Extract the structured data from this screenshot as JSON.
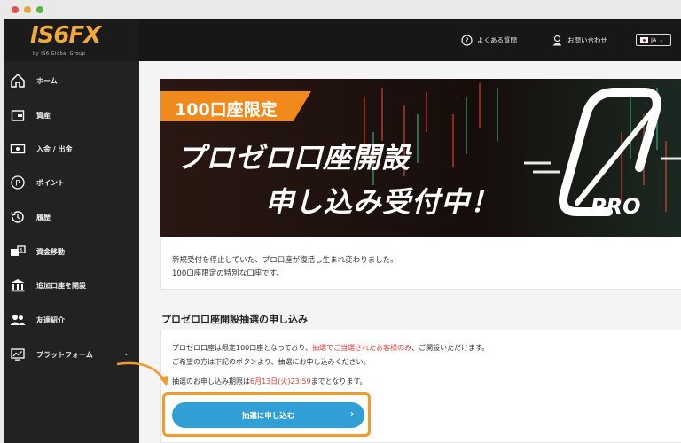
{
  "logo": {
    "text": "IS6FX",
    "sub": "by IS6 Global Group"
  },
  "topbar": {
    "faq": "よくある質問",
    "contact": "お問い合わせ",
    "lang": "JA"
  },
  "sidebar": {
    "items": [
      {
        "label": "ホーム",
        "icon": "home-icon"
      },
      {
        "label": "資産",
        "icon": "wallet-icon"
      },
      {
        "label": "入金 / 出金",
        "icon": "deposit-icon"
      },
      {
        "label": "ポイント",
        "icon": "points-icon"
      },
      {
        "label": "履歴",
        "icon": "history-icon"
      },
      {
        "label": "資金移動",
        "icon": "transfer-icon"
      },
      {
        "label": "追加口座を開設",
        "icon": "bank-icon"
      },
      {
        "label": "友達紹介",
        "icon": "friends-icon"
      },
      {
        "label": "プラットフォーム",
        "icon": "platform-icon"
      }
    ]
  },
  "banner": {
    "tag": "100口座限定",
    "line1": "プロゼロ口座開設",
    "line2": "申し込み受付中！",
    "badge": "PRO"
  },
  "intro": {
    "line1": "新規受付を停止していた、プロ口座が復活し生まれ変わりました。",
    "line2": "100口座限定の特別な口座です。"
  },
  "section": {
    "title": "プロゼロ口座開設抽選の申し込み",
    "p1_a": "プロゼロ口座は限定100口座となっており、",
    "p1_red": "抽選でご当選されたお客様のみ",
    "p1_b": "、ご開設いただけます。",
    "p2": "ご希望の方は下記のボタンより、抽選にお申し込みください。",
    "deadline_a": "抽選のお申し込み期限は",
    "deadline_red": "6月13日(火)23:59",
    "deadline_b": "までとなります。",
    "button": "抽選に申し込む"
  },
  "colors": {
    "accent": "#f29b2a",
    "button": "#2f9fd6",
    "sidebar": "#222222",
    "red": "#e53935"
  }
}
